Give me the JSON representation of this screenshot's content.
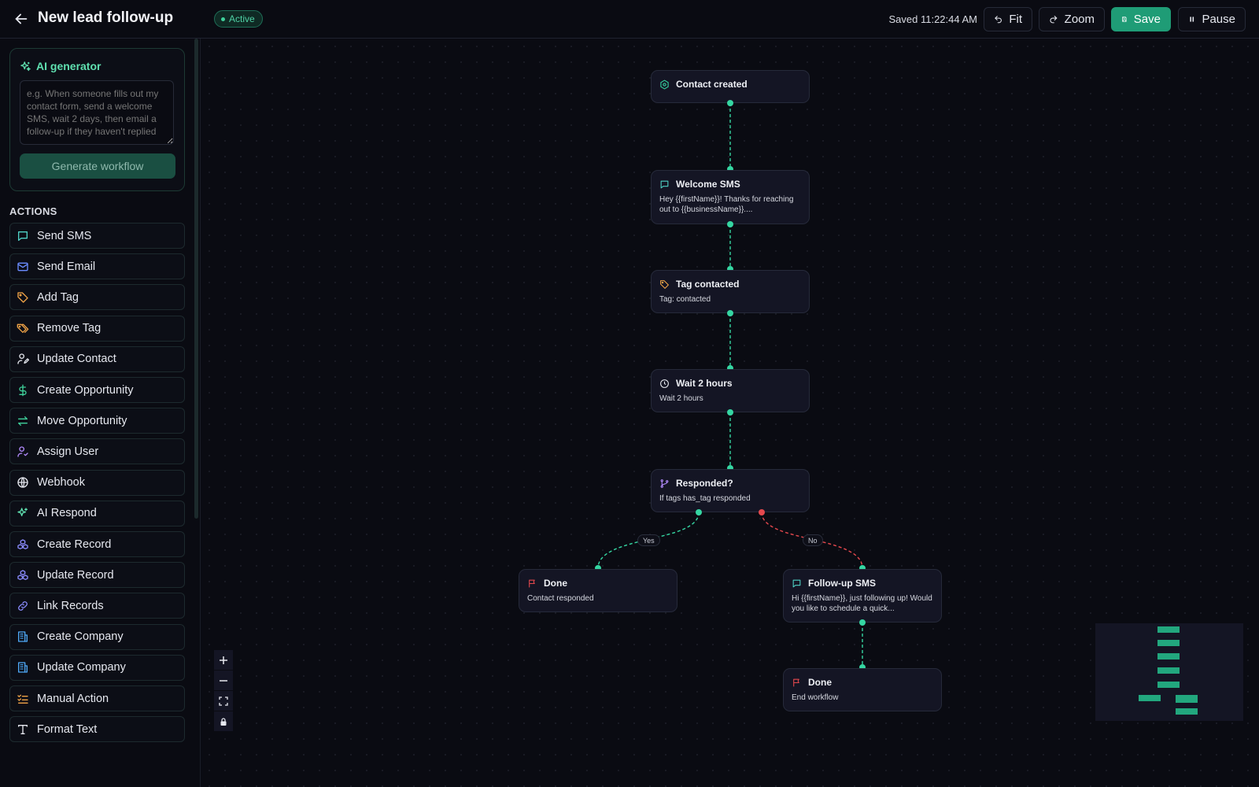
{
  "header": {
    "title": "New lead follow-up",
    "status": "Active",
    "saved": "Saved 11:22:44 AM",
    "buttons": {
      "fit": "Fit",
      "zoom": "Zoom",
      "save": "Save",
      "pause": "Pause"
    }
  },
  "sidebar": {
    "ai": {
      "title": "AI generator",
      "placeholder": "e.g. When someone fills out my contact form, send a welcome SMS, wait 2 days, then email a follow-up if they haven't replied",
      "button": "Generate workflow"
    },
    "actions_title": "ACTIONS",
    "actions": [
      {
        "label": "Send SMS",
        "icon": "message-icon",
        "color": "#4fd1c5"
      },
      {
        "label": "Send Email",
        "icon": "mail-icon",
        "color": "#6b8cff"
      },
      {
        "label": "Add Tag",
        "icon": "tag-icon",
        "color": "#f0a347"
      },
      {
        "label": "Remove Tag",
        "icon": "tags-icon",
        "color": "#f0a347"
      },
      {
        "label": "Update Contact",
        "icon": "user-edit-icon",
        "color": "#e6e8ef"
      },
      {
        "label": "Create Opportunity",
        "icon": "dollar-icon",
        "color": "#3fd19b"
      },
      {
        "label": "Move Opportunity",
        "icon": "arrows-icon",
        "color": "#3fd19b"
      },
      {
        "label": "Assign User",
        "icon": "user-check-icon",
        "color": "#b48cff"
      },
      {
        "label": "Webhook",
        "icon": "globe-icon",
        "color": "#e6e8ef"
      },
      {
        "label": "AI Respond",
        "icon": "sparkles-icon",
        "color": "#5fe0b0"
      },
      {
        "label": "Create Record",
        "icon": "boxes-icon",
        "color": "#8b8cff"
      },
      {
        "label": "Update Record",
        "icon": "boxes-icon",
        "color": "#8b8cff"
      },
      {
        "label": "Link Records",
        "icon": "link-icon",
        "color": "#8b8cff"
      },
      {
        "label": "Create Company",
        "icon": "building-icon",
        "color": "#4ea8f5"
      },
      {
        "label": "Update Company",
        "icon": "building-icon",
        "color": "#4ea8f5"
      },
      {
        "label": "Manual Action",
        "icon": "checklist-icon",
        "color": "#f0a347"
      },
      {
        "label": "Format Text",
        "icon": "type-icon",
        "color": "#e6e8ef"
      }
    ]
  },
  "workflow": {
    "nodes": {
      "contact_created": {
        "title": "Contact created"
      },
      "welcome_sms": {
        "title": "Welcome SMS",
        "sub": "Hey {{firstName}}! Thanks for reaching out to {{businessName}}...."
      },
      "tag_contacted": {
        "title": "Tag contacted",
        "sub": "Tag: contacted"
      },
      "wait": {
        "title": "Wait 2 hours",
        "sub": "Wait 2 hours"
      },
      "responded": {
        "title": "Responded?",
        "sub": "If tags has_tag responded"
      },
      "done_yes": {
        "title": "Done",
        "sub": "Contact responded"
      },
      "followup_sms": {
        "title": "Follow-up SMS",
        "sub": "Hi {{firstName}}, just following up! Would you like to schedule a quick..."
      },
      "done_end": {
        "title": "Done",
        "sub": "End workflow"
      }
    },
    "edge_labels": {
      "yes": "Yes",
      "no": "No"
    },
    "colors": {
      "accent": "#35d6a2",
      "no_branch": "#e5484d"
    }
  }
}
